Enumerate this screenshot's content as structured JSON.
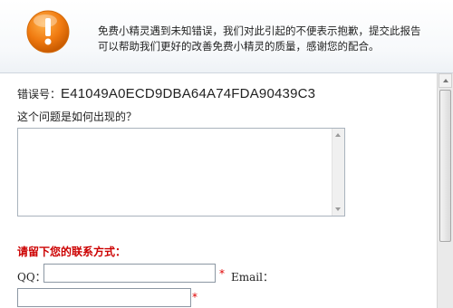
{
  "header": {
    "message_line1": "免费小精灵遇到未知错误，我们对此引起的不便表示抱歉，提交此报告",
    "message_line2": "可以帮助我们更好的改善免费小精灵的质量，感谢您的配合。"
  },
  "error": {
    "label": "错误号：",
    "code": "E41049A0ECD9DBA64A74FDA90439C3"
  },
  "question": {
    "label": "这个问题是如何出现的？",
    "value": ""
  },
  "contact": {
    "title": "请留下您的联系方式：",
    "qq_label": "QQ：",
    "qq_value": "",
    "required_mark": "*",
    "email_label": "Email：",
    "email_value": ""
  },
  "colors": {
    "required": "#e00000",
    "contact_title": "#cc0000",
    "icon_orange": "#f07a10"
  }
}
